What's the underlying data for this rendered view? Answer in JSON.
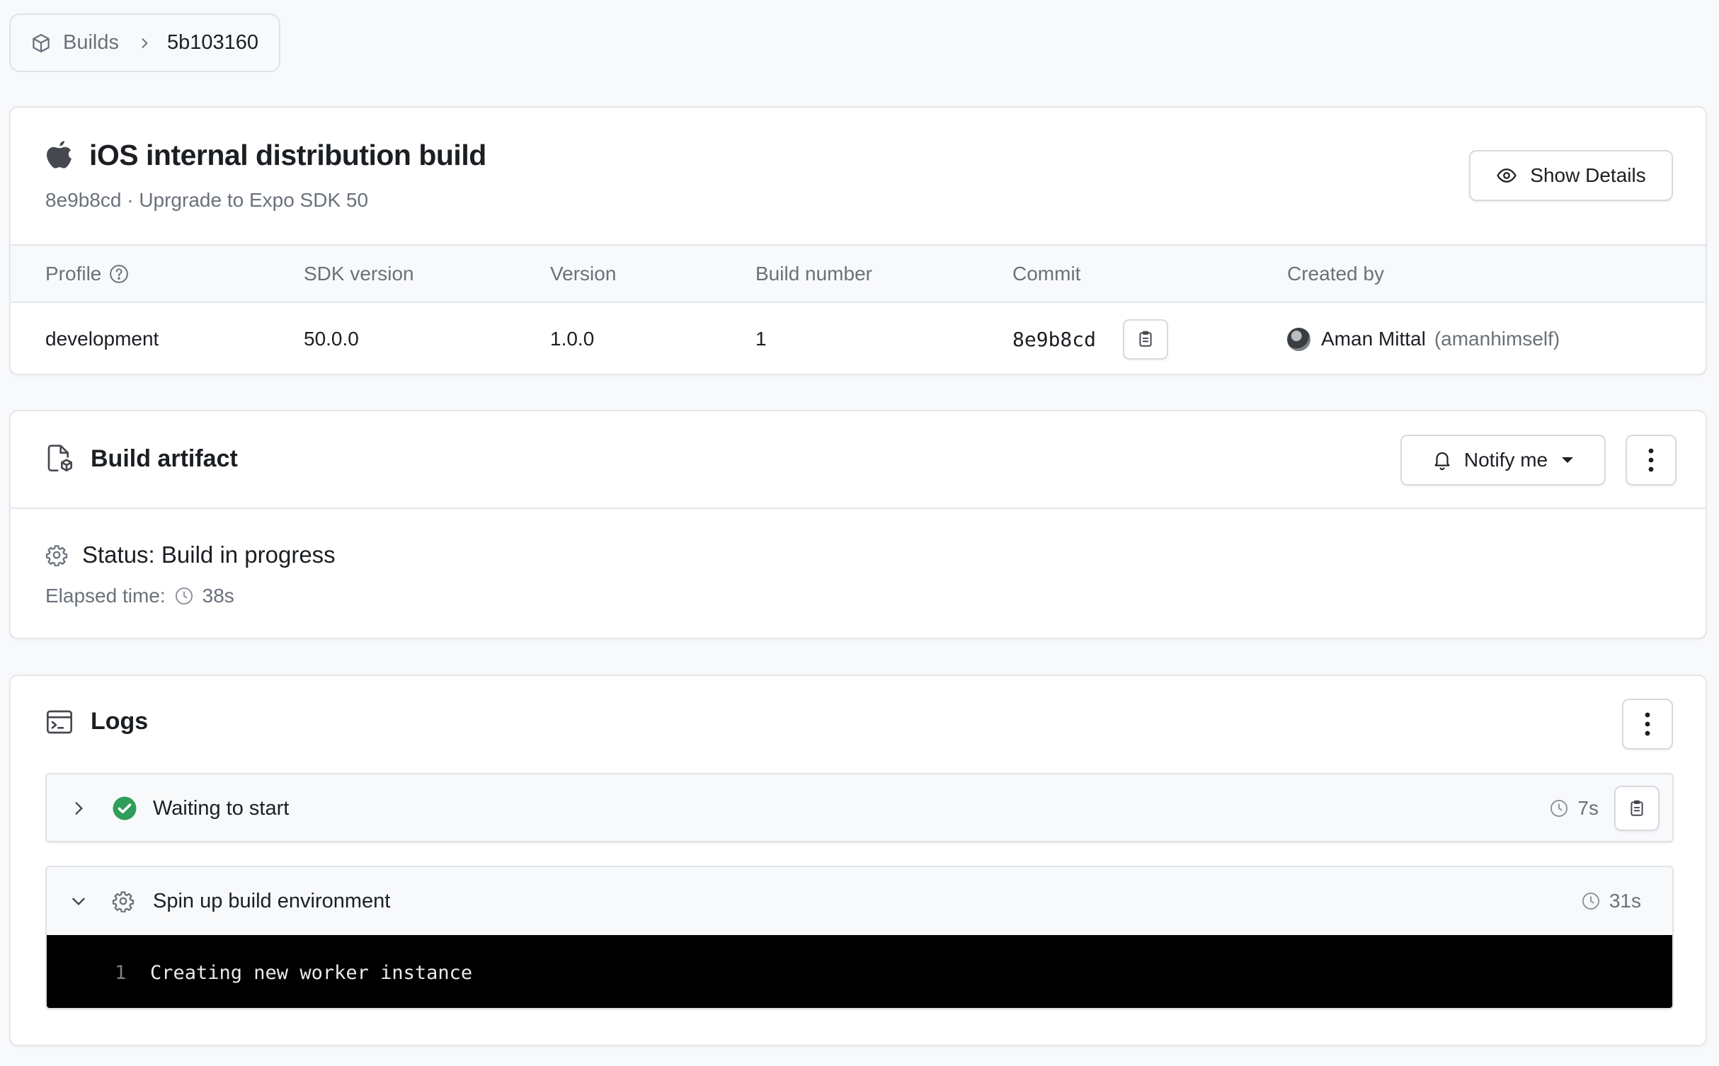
{
  "breadcrumb": {
    "parent": "Builds",
    "current": "5b103160"
  },
  "build": {
    "title": "iOS internal distribution build",
    "subtitle": "8e9b8cd · Uprgrade to Expo SDK 50",
    "show_details_label": "Show Details",
    "platform_icon": "apple-icon"
  },
  "meta": {
    "headers": {
      "profile": "Profile",
      "sdk_version": "SDK version",
      "version": "Version",
      "build_number": "Build number",
      "commit": "Commit",
      "created_by": "Created by"
    },
    "values": {
      "profile": "development",
      "sdk_version": "50.0.0",
      "version": "1.0.0",
      "build_number": "1",
      "commit": "8e9b8cd",
      "created_by_name": "Aman Mittal",
      "created_by_username": "(amanhimself)"
    }
  },
  "artifact": {
    "title": "Build artifact",
    "notify_label": "Notify me",
    "status": "Status: Build in progress",
    "elapsed_label": "Elapsed time:",
    "elapsed_value": "38s"
  },
  "logs": {
    "title": "Logs",
    "steps": [
      {
        "label": "Waiting to start",
        "duration": "7s",
        "state": "success",
        "expanded": false
      },
      {
        "label": "Spin up build environment",
        "duration": "31s",
        "state": "in-progress",
        "expanded": true
      }
    ],
    "lines": [
      {
        "number": "1",
        "text": "Creating new worker instance"
      }
    ]
  },
  "colors": {
    "success": "#2f9e5a",
    "text": "#1b1f23",
    "muted": "#6a717a",
    "terminal_bg": "#000000",
    "page_bg": "#f8f9fb"
  }
}
